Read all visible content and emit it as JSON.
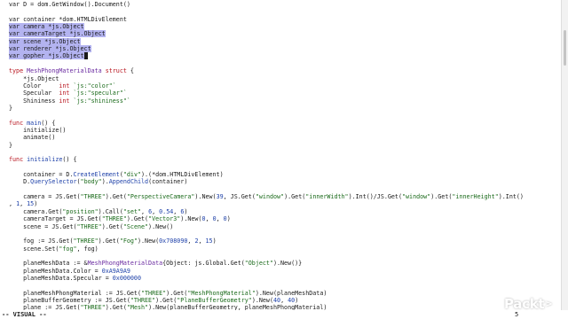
{
  "editor": {
    "lines": [
      [
        {
          "t": "var D = dom.GetWindow().Document()"
        }
      ],
      [],
      [
        {
          "t": "var container *dom.HTMLDivElement"
        }
      ],
      [
        {
          "t": "var camera *js.Object",
          "c": "sel"
        }
      ],
      [
        {
          "t": "var cameraTarget *js.Object",
          "c": "sel"
        }
      ],
      [
        {
          "t": "var scene *js.Object",
          "c": "sel"
        }
      ],
      [
        {
          "t": "var renderer *js.Object",
          "c": "sel"
        }
      ],
      [
        {
          "t": "var gopher *js.Object",
          "c": "sel"
        },
        {
          "t": " ",
          "c": "cursor"
        }
      ],
      [],
      [
        {
          "t": "type",
          "c": "kw"
        },
        {
          "t": " MeshPhongMaterialData ",
          "c": "ty"
        },
        {
          "t": "struct",
          "c": "kw"
        },
        {
          "t": " {"
        }
      ],
      [
        {
          "t": "    *js.Object"
        }
      ],
      [
        {
          "t": "    Color     "
        },
        {
          "t": "int",
          "c": "kw"
        },
        {
          "t": " `js:\"color\"`",
          "c": "st"
        }
      ],
      [
        {
          "t": "    Specular  "
        },
        {
          "t": "int",
          "c": "kw"
        },
        {
          "t": " `js:\"specular\"`",
          "c": "st"
        }
      ],
      [
        {
          "t": "    Shininess "
        },
        {
          "t": "int",
          "c": "kw"
        },
        {
          "t": " `js:\"shininess\"`",
          "c": "st"
        }
      ],
      [
        {
          "t": "}"
        }
      ],
      [],
      [
        {
          "t": "func",
          "c": "kw"
        },
        {
          "t": " main",
          "c": "fn"
        },
        {
          "t": "() {"
        }
      ],
      [
        {
          "t": "    initialize()"
        }
      ],
      [
        {
          "t": "    animate()"
        }
      ],
      [
        {
          "t": "}"
        }
      ],
      [],
      [
        {
          "t": "func",
          "c": "kw"
        },
        {
          "t": " initialize",
          "c": "fn"
        },
        {
          "t": "() {"
        }
      ],
      [],
      [
        {
          "t": "    container = D."
        },
        {
          "t": "CreateElement",
          "c": "fn"
        },
        {
          "t": "("
        },
        {
          "t": "\"div\"",
          "c": "st"
        },
        {
          "t": ").(*dom.HTMLDivElement)"
        }
      ],
      [
        {
          "t": "    D."
        },
        {
          "t": "QuerySelector",
          "c": "fn"
        },
        {
          "t": "("
        },
        {
          "t": "\"body\"",
          "c": "st"
        },
        {
          "t": ")."
        },
        {
          "t": "AppendChild",
          "c": "fn"
        },
        {
          "t": "(container)"
        }
      ],
      [],
      [
        {
          "t": "    camera = JS.Get("
        },
        {
          "t": "\"THREE\"",
          "c": "st"
        },
        {
          "t": ").Get("
        },
        {
          "t": "\"PerspectiveCamera\"",
          "c": "st"
        },
        {
          "t": ").New("
        },
        {
          "t": "39",
          "c": "nu"
        },
        {
          "t": ", JS.Get("
        },
        {
          "t": "\"window\"",
          "c": "st"
        },
        {
          "t": ").Get("
        },
        {
          "t": "\"innerWidth\"",
          "c": "st"
        },
        {
          "t": ").Int()/JS.Get("
        },
        {
          "t": "\"window\"",
          "c": "st"
        },
        {
          "t": ").Get("
        },
        {
          "t": "\"innerHeight\"",
          "c": "st"
        },
        {
          "t": ").Int()"
        }
      ],
      [
        {
          "t": ", "
        },
        {
          "t": "1",
          "c": "nu"
        },
        {
          "t": ", "
        },
        {
          "t": "15",
          "c": "nu"
        },
        {
          "t": ")"
        }
      ],
      [
        {
          "t": "    camera.Get("
        },
        {
          "t": "\"position\"",
          "c": "st"
        },
        {
          "t": ").Call("
        },
        {
          "t": "\"set\"",
          "c": "st"
        },
        {
          "t": ", "
        },
        {
          "t": "6",
          "c": "nu"
        },
        {
          "t": ", "
        },
        {
          "t": "0.54",
          "c": "nu"
        },
        {
          "t": ", "
        },
        {
          "t": "6",
          "c": "nu"
        },
        {
          "t": ")"
        }
      ],
      [
        {
          "t": "    cameraTarget = JS.Get("
        },
        {
          "t": "\"THREE\"",
          "c": "st"
        },
        {
          "t": ").Get("
        },
        {
          "t": "\"Vector3\"",
          "c": "st"
        },
        {
          "t": ").New("
        },
        {
          "t": "0",
          "c": "nu"
        },
        {
          "t": ", "
        },
        {
          "t": "0",
          "c": "nu"
        },
        {
          "t": ", "
        },
        {
          "t": "0",
          "c": "nu"
        },
        {
          "t": ")"
        }
      ],
      [
        {
          "t": "    scene = JS.Get("
        },
        {
          "t": "\"THREE\"",
          "c": "st"
        },
        {
          "t": ").Get("
        },
        {
          "t": "\"Scene\"",
          "c": "st"
        },
        {
          "t": ").New()"
        }
      ],
      [],
      [
        {
          "t": "    fog := JS.Get("
        },
        {
          "t": "\"THREE\"",
          "c": "st"
        },
        {
          "t": ").Get("
        },
        {
          "t": "\"Fog\"",
          "c": "st"
        },
        {
          "t": ").New("
        },
        {
          "t": "0x708090",
          "c": "nu"
        },
        {
          "t": ", "
        },
        {
          "t": "2",
          "c": "nu"
        },
        {
          "t": ", "
        },
        {
          "t": "15",
          "c": "nu"
        },
        {
          "t": ")"
        }
      ],
      [
        {
          "t": "    scene.Set("
        },
        {
          "t": "\"fog\"",
          "c": "st"
        },
        {
          "t": ", fog)"
        }
      ],
      [],
      [
        {
          "t": "    planeMeshData := &"
        },
        {
          "t": "MeshPhongMaterialData",
          "c": "ty"
        },
        {
          "t": "{Object: js.Global.Get("
        },
        {
          "t": "\"Object\"",
          "c": "st"
        },
        {
          "t": ").New()}"
        }
      ],
      [
        {
          "t": "    planeMeshData.Color = "
        },
        {
          "t": "0xA9A9A9",
          "c": "nu"
        }
      ],
      [
        {
          "t": "    planeMeshData.Specular = "
        },
        {
          "t": "0x000000",
          "c": "nu"
        }
      ],
      [],
      [
        {
          "t": "    planeMeshPhongMaterial := JS.Get("
        },
        {
          "t": "\"THREE\"",
          "c": "st"
        },
        {
          "t": ").Get("
        },
        {
          "t": "\"MeshPhongMaterial\"",
          "c": "st"
        },
        {
          "t": ").New(planeMeshData)"
        }
      ],
      [
        {
          "t": "    planeBufferGeometry := JS.Get("
        },
        {
          "t": "\"THREE\"",
          "c": "st"
        },
        {
          "t": ").Get("
        },
        {
          "t": "\"PlaneBufferGeometry\"",
          "c": "st"
        },
        {
          "t": ").New("
        },
        {
          "t": "40",
          "c": "nu"
        },
        {
          "t": ", "
        },
        {
          "t": "40",
          "c": "nu"
        },
        {
          "t": ")"
        }
      ],
      [
        {
          "t": "    plane := JS.Get("
        },
        {
          "t": "\"THREE\"",
          "c": "st"
        },
        {
          "t": ").Get("
        },
        {
          "t": "\"Mesh\"",
          "c": "st"
        },
        {
          "t": ").New(planeBufferGeometry, planeMeshPhongMaterial)"
        }
      ]
    ]
  },
  "statusline": {
    "mode": "-- VISUAL --",
    "selection_count": "5"
  },
  "logo": {
    "text": "Packt",
    "chevron": ">"
  },
  "colors": {
    "selection": "#b3b3f0",
    "keyword": "#b8141e",
    "type": "#6a2ba0",
    "function": "#1c3fa8",
    "string": "#1a6a1a"
  }
}
